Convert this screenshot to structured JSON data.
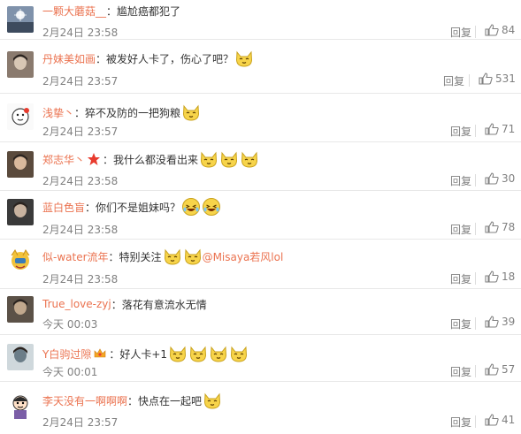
{
  "reply_label": "回复",
  "comments": [
    {
      "user": "一颗大蘑菇__",
      "sep": "：",
      "text": "尴尬癌都犯了",
      "emojis": 0,
      "time": "2月24日 23:58",
      "likes": "84"
    },
    {
      "user": "丹妹美如画",
      "sep": "：",
      "text": "被发好人卡了，伤心了吧？",
      "emojis": 1,
      "time": "2月24日 23:57",
      "likes": "531"
    },
    {
      "user": "浅挚丶",
      "sep": "：",
      "text": "猝不及防的一把狗粮",
      "emojis": 1,
      "time": "2月24日 23:57",
      "likes": "71"
    },
    {
      "user": "郑志华丶",
      "sep": "：",
      "text": "我什么都没看出来",
      "emojis": 3,
      "time": "2月24日 23:58",
      "likes": "30"
    },
    {
      "user": "蓝白色盲",
      "sep": "：",
      "text": "你们不是姐妹吗？",
      "emojis": 2,
      "time": "2月24日 23:58",
      "likes": "78"
    },
    {
      "user": "似-water流年",
      "sep": "：",
      "text": "特别关注",
      "emojis": 2,
      "mention": "@Misaya若风lol",
      "time": "2月24日 23:58",
      "likes": "18"
    },
    {
      "user": "True_love-zyj",
      "sep": "：",
      "text": "落花有意流水无情",
      "emojis": 0,
      "time": "今天 00:03",
      "likes": "39"
    },
    {
      "user": "Y白驹过隙",
      "sep": "：",
      "text": "好人卡+1",
      "emojis": 4,
      "time": "今天 00:01",
      "likes": "57"
    },
    {
      "user": "李天没有一啊啊啊",
      "sep": "：",
      "text": "快点在一起吧",
      "emojis": 1,
      "time": "2月24日 23:57",
      "likes": "41"
    }
  ]
}
